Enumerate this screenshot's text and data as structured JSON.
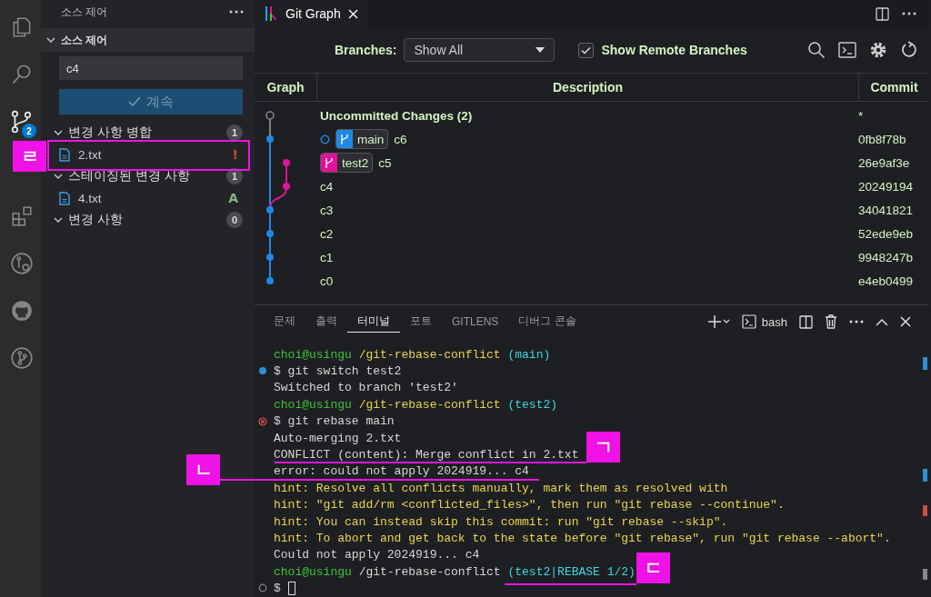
{
  "activity_bar": [
    {
      "kind": "files",
      "selected": false
    },
    {
      "kind": "search",
      "selected": false
    },
    {
      "kind": "source-control",
      "selected": true,
      "badge": "2"
    },
    {
      "kind": "extensions",
      "selected": false
    },
    {
      "kind": "git-graph",
      "selected": false
    },
    {
      "kind": "github",
      "selected": false
    },
    {
      "kind": "branch",
      "selected": false
    }
  ],
  "sidebar": {
    "title": "소스 제어",
    "section": {
      "title": "소스 제어",
      "expanded": true
    },
    "commit_message": {
      "value": "c4"
    },
    "continue_button": {
      "label": "계속"
    },
    "groups": [
      {
        "title": "변경 사항 병합",
        "count": "1",
        "expanded": true,
        "files": [
          {
            "name": "2.txt",
            "status": "!",
            "color": "#c74e39"
          }
        ]
      },
      {
        "title": "스테이징된 변경 사항",
        "count": "1",
        "expanded": true,
        "files": [
          {
            "name": "4.txt",
            "status": "A",
            "color": "#81b88b"
          }
        ]
      },
      {
        "title": "변경 사항",
        "count": "0",
        "expanded": true
      }
    ]
  },
  "editor_tab": {
    "title": "Git Graph"
  },
  "git_graph": {
    "branches_label": "Branches:",
    "branch_select": {
      "value": "Show All"
    },
    "show_remote": {
      "label": "Show Remote Branches",
      "checked": true
    },
    "columns": [
      "Graph",
      "Description",
      "Commit"
    ],
    "commits": [
      {
        "kind": "uncommitted",
        "description": "Uncommitted Changes (2)",
        "hash": "*"
      },
      {
        "kind": "main",
        "description": "c6",
        "hash": "0fb8f78b",
        "head": true,
        "refs": [
          {
            "name": "main",
            "color": "#1e88e5"
          }
        ]
      },
      {
        "kind": "side",
        "description": "c5",
        "hash": "26e9af3e",
        "head": false,
        "refs": [
          {
            "name": "test2",
            "color": "#e0119a"
          }
        ]
      },
      {
        "kind": "side",
        "description": "c4",
        "hash": "20249194",
        "head": false
      },
      {
        "kind": "main",
        "description": "c3",
        "hash": "34041821",
        "head": false
      },
      {
        "kind": "main",
        "description": "c2",
        "hash": "52ede9eb",
        "head": false
      },
      {
        "kind": "main",
        "description": "c1",
        "hash": "9948247b",
        "head": false
      },
      {
        "kind": "main",
        "description": "c0",
        "hash": "e4eb0499",
        "head": false
      }
    ]
  },
  "panel": {
    "tabs": [
      {
        "label": "문제",
        "selected": false
      },
      {
        "label": "출력",
        "selected": false
      },
      {
        "label": "터미널",
        "selected": true
      },
      {
        "label": "포트",
        "selected": false
      },
      {
        "label": "GITLENS",
        "selected": false
      },
      {
        "label": "디버그 콘솔",
        "selected": false
      }
    ],
    "shell": "bash",
    "terminal": [
      {
        "kind": "plain",
        "segments": [
          {
            "kind": "user",
            "text": "choi@usingu"
          },
          {
            "kind": "path",
            "text": " /git-rebase-conflict "
          },
          {
            "kind": "branch",
            "text": "(main)"
          }
        ]
      },
      {
        "kind": "success",
        "segments": [
          {
            "kind": "plain",
            "text": "$ git switch test2"
          }
        ]
      },
      {
        "kind": "plain",
        "segments": [
          {
            "kind": "plain",
            "text": "Switched to branch 'test2'"
          }
        ]
      },
      {
        "kind": "plain",
        "segments": [
          {
            "kind": "user",
            "text": "choi@usingu"
          },
          {
            "kind": "path",
            "text": " /git-rebase-conflict "
          },
          {
            "kind": "branch",
            "text": "(test2)"
          }
        ]
      },
      {
        "kind": "error",
        "segments": [
          {
            "kind": "plain",
            "text": "$ git rebase main"
          }
        ]
      },
      {
        "kind": "plain",
        "segments": [
          {
            "kind": "plain",
            "text": "Auto-merging 2.txt"
          }
        ]
      },
      {
        "kind": "plain",
        "segments": [
          {
            "kind": "plain",
            "text": "CONFLICT (content): Merge conflict in 2.txt"
          }
        ]
      },
      {
        "kind": "plain",
        "segments": [
          {
            "kind": "plain",
            "text": "error: could not apply 2024919... c4"
          }
        ]
      },
      {
        "kind": "plain",
        "segments": [
          {
            "kind": "hint",
            "text": "hint: Resolve all conflicts manually, mark them as resolved with"
          }
        ]
      },
      {
        "kind": "plain",
        "segments": [
          {
            "kind": "hint",
            "text": "hint: \"git add/rm <conflicted_files>\", then run \"git rebase --continue\"."
          }
        ]
      },
      {
        "kind": "plain",
        "segments": [
          {
            "kind": "hint",
            "text": "hint: You can instead skip this commit: run \"git rebase --skip\"."
          }
        ]
      },
      {
        "kind": "plain",
        "segments": [
          {
            "kind": "hint",
            "text": "hint: To abort and get back to the state before \"git rebase\", run \"git rebase --abort\"."
          }
        ]
      },
      {
        "kind": "plain",
        "segments": [
          {
            "kind": "plain",
            "text": "Could not apply 2024919... c4"
          }
        ]
      },
      {
        "kind": "plain",
        "segments": [
          {
            "kind": "user",
            "text": "choi@usingu"
          },
          {
            "kind": "plain",
            "text": " /git-rebase-conflict "
          },
          {
            "kind": "branch",
            "text": "(test2|REBASE 1/2)"
          }
        ]
      },
      {
        "kind": "pending",
        "cursor": true,
        "segments": [
          {
            "kind": "plain",
            "text": "$"
          }
        ]
      }
    ]
  },
  "annotations": [
    {
      "label": "ㄹ",
      "kind": "box"
    },
    {
      "label": "ㄱ",
      "kind": "underline"
    },
    {
      "label": "ㄴ",
      "kind": "underline"
    },
    {
      "label": "ㄷ",
      "kind": "underline"
    }
  ]
}
